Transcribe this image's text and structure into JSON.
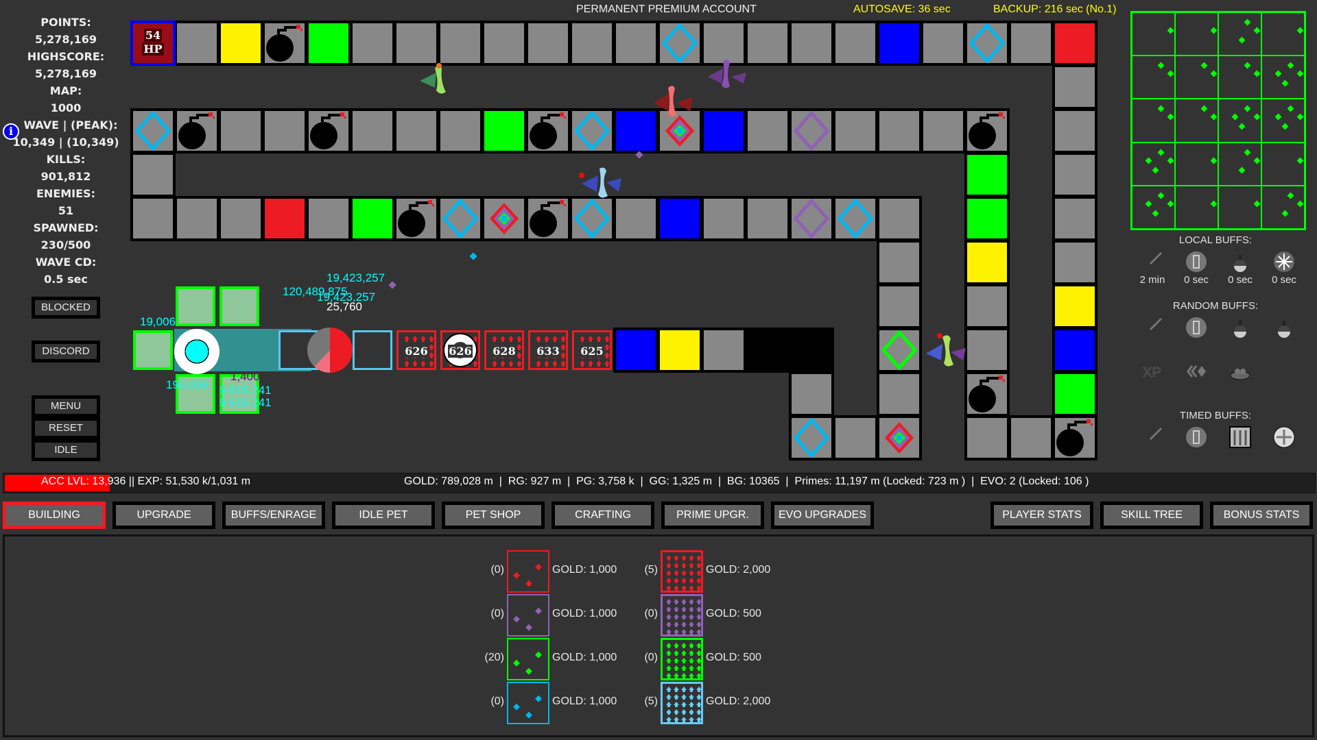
{
  "header": {
    "account": "PERMANENT PREMIUM ACCOUNT",
    "autosave": "AUTOSAVE: 36 sec",
    "backup": "BACKUP: 216 sec (No.1)",
    "autosave_color": "#ffff00"
  },
  "stats": {
    "points_label": "POINTS:",
    "points": "5,278,169",
    "highscore_label": "HIGHSCORE:",
    "highscore": "5,278,169",
    "map_label": "MAP:",
    "map": "1000",
    "wave_label": "WAVE | (PEAK):",
    "wave": "10,349 | (10,349)",
    "kills_label": "KILLS:",
    "kills": "901,812",
    "enemies_label": "ENEMIES:",
    "enemies": "51",
    "spawned_label": "SPAWNED:",
    "spawned": "230/500",
    "wavecd_label": "WAVE CD:",
    "wavecd": "0.5 sec",
    "info_glyph": "i"
  },
  "left_buttons": {
    "blocked": "BLOCKED",
    "discord": "DISCORD",
    "menu": "MENU",
    "reset": "RESET",
    "idle": "IDLE"
  },
  "base": {
    "hp": "54",
    "hp_label": "HP"
  },
  "map_tiles": {
    "row0": [
      "gray",
      "yellow",
      "bomb",
      "green",
      "gray",
      "gray",
      "gray",
      "gray",
      "gray",
      "gray",
      "gray",
      "diamond-cyan",
      "gray",
      "gray",
      "gray",
      "gray",
      "blue",
      "gray",
      "diamond-cyan",
      "gray",
      "red"
    ],
    "row2": [
      "diamond-cyan",
      "bomb",
      "gray",
      "gray",
      "bomb",
      "gray",
      "gray",
      "gray",
      "green",
      "bomb",
      "diamond-cyan",
      "blue",
      "diamond-multi",
      "blue",
      "gray",
      "diamond-purple",
      "gray",
      "gray",
      "gray",
      "bomb"
    ],
    "row4": [
      "gray",
      "gray",
      "gray",
      "red",
      "gray",
      "green",
      "bomb",
      "diamond-cyan",
      "diamond-multi",
      "bomb",
      "diamond-cyan",
      "gray",
      "blue",
      "gray",
      "gray",
      "diamond-purple",
      "diamond-cyan",
      "gray"
    ],
    "row7_right": [
      "gray",
      "gray",
      "blue",
      "yellow",
      "gray"
    ],
    "right_col19": [
      "green",
      "green",
      "yellow",
      "gray",
      "gray",
      "bomb",
      "gray"
    ],
    "right_col21": [
      "gray",
      "gray",
      "gray",
      "gray",
      "gray",
      "yellow",
      "blue",
      "green",
      "bomb"
    ],
    "col17": [
      "gray",
      "gray",
      "gray",
      "diamond-green",
      "gray",
      "diamond-multi"
    ],
    "col14_15": [
      "gray",
      "diamond-cyan",
      "gray"
    ],
    "col20": [
      "gray"
    ]
  },
  "towers": [
    {
      "value": "626",
      "style": "red-arrows"
    },
    {
      "value": "626",
      "style": "red-ring"
    },
    {
      "value": "628",
      "style": "red-arrows"
    },
    {
      "value": "633",
      "style": "red-triangles"
    },
    {
      "value": "625",
      "style": "red-arrows"
    }
  ],
  "floating_damage": {
    "top1": "19,423,257",
    "top2": "120,489,875",
    "top3": "19,423,257",
    "white": "25,760",
    "bottom1": "1,400",
    "bottom2": "9,616,241",
    "bottom3": "9,616,241",
    "left1": "19,006",
    "left2": "190,006"
  },
  "buffs": {
    "local_title": "LOCAL BUFFS:",
    "local": [
      {
        "icon": "sword-icon",
        "time": "2 min"
      },
      {
        "icon": "shield-icon",
        "time": "0 sec"
      },
      {
        "icon": "potion-icon",
        "time": "0 sec"
      },
      {
        "icon": "snowflake-icon",
        "time": "0 sec"
      }
    ],
    "random_title": "RANDOM BUFFS:",
    "random": [
      {
        "icon": "sword-icon"
      },
      {
        "icon": "shield-icon"
      },
      {
        "icon": "potion-icon"
      },
      {
        "icon": "potion-icon"
      },
      {
        "icon": "xp-icon",
        "glyph": "XP"
      },
      {
        "icon": "speed-icon",
        "glyph": "«◆"
      },
      {
        "icon": "gold-pile-icon"
      }
    ],
    "timed_title": "TIMED BUFFS:",
    "timed": [
      {
        "icon": "sword-icon"
      },
      {
        "icon": "shield-icon"
      },
      {
        "icon": "arrows-up-icon"
      },
      {
        "icon": "move-icon"
      }
    ]
  },
  "statusbar": {
    "acc_progress": 0.08,
    "acc_text": "ACC LVL: 13,936 || EXP: 51,530 k/1,031 m",
    "resources": "GOLD: 789,028 m  |  RG: 927 m  |  PG: 3,758 k  |  GG: 1,325 m  |  BG: 10365  |  Primes: 11,197 m (Locked: 723 m )  |  EVO: 2 (Locked: 106 )"
  },
  "tabs": [
    {
      "label": "BUILDING",
      "active": true
    },
    {
      "label": "UPGRADE"
    },
    {
      "label": "BUFFS/ENRAGE"
    },
    {
      "label": "IDLE PET"
    },
    {
      "label": "PET SHOP"
    },
    {
      "label": "CRAFTING"
    },
    {
      "label": "PRIME UPGR."
    },
    {
      "label": "EVO UPGRADES"
    },
    {
      "label": "PLAYER STATS"
    },
    {
      "label": "SKILL TREE"
    },
    {
      "label": "BONUS STATS"
    }
  ],
  "shop": {
    "left": [
      {
        "count": "(0)",
        "price": "GOLD: 1,000",
        "color": "#ed1c24"
      },
      {
        "count": "(0)",
        "price": "GOLD: 1,000",
        "color": "#8f62b5"
      },
      {
        "count": "(20)",
        "price": "GOLD: 1,000",
        "color": "#00ff00"
      },
      {
        "count": "(0)",
        "price": "GOLD: 1,000",
        "color": "#00b7ef"
      }
    ],
    "right": [
      {
        "count": "(5)",
        "price": "GOLD: 2,000",
        "color": "#ed1c24"
      },
      {
        "count": "(0)",
        "price": "GOLD: 500",
        "color": "#8f62b5"
      },
      {
        "count": "(0)",
        "price": "GOLD: 500",
        "color": "#00ff00"
      },
      {
        "count": "(5)",
        "price": "GOLD: 2,000",
        "color": "#66ccf5"
      }
    ]
  },
  "colors": {
    "background": "#333333",
    "tile_gray": "#888888",
    "path_border": "#000000",
    "accent_green": "#00ff00",
    "accent_red": "#ed1c24",
    "damage_text": "#00ffff"
  }
}
